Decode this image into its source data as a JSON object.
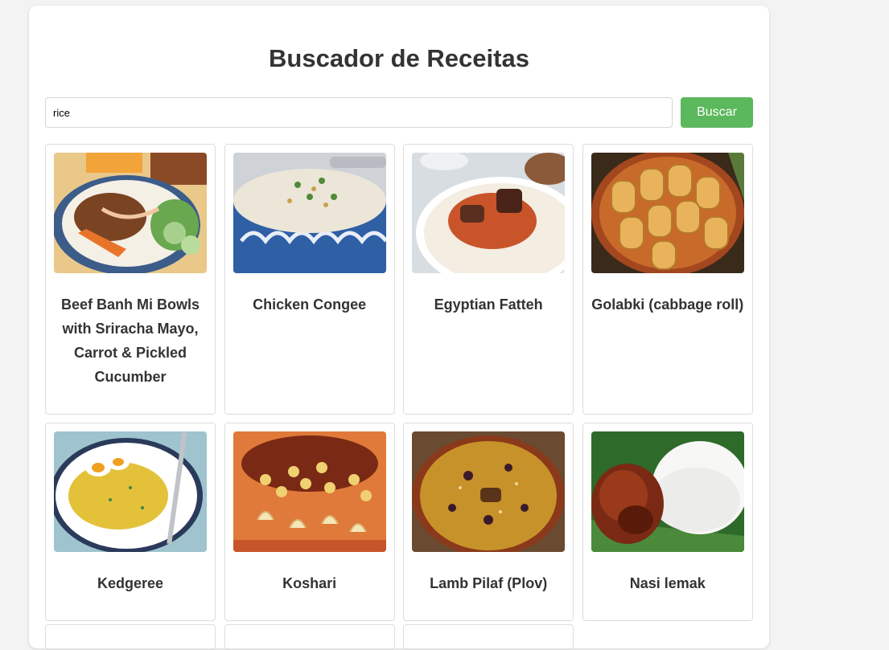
{
  "page": {
    "title": "Buscador de Receitas"
  },
  "search": {
    "value": "rice",
    "button_label": "Buscar"
  },
  "colors": {
    "accent": "#5cb85c",
    "background": "#f3f3f3",
    "card_border": "#dddddd",
    "text": "#333333"
  },
  "recipes": [
    {
      "title": "Beef Banh Mi Bowls with Sriracha Mayo, Carrot & Pickled Cucumber",
      "image": "beef-banh-mi-bowl-photo"
    },
    {
      "title": "Chicken Congee",
      "image": "chicken-congee-photo"
    },
    {
      "title": "Egyptian Fatteh",
      "image": "egyptian-fatteh-photo"
    },
    {
      "title": "Golabki (cabbage roll)",
      "image": "golabki-photo"
    },
    {
      "title": "Kedgeree",
      "image": "kedgeree-photo"
    },
    {
      "title": "Koshari",
      "image": "koshari-photo"
    },
    {
      "title": "Lamb Pilaf (Plov)",
      "image": "lamb-pilaf-photo"
    },
    {
      "title": "Nasi lemak",
      "image": "nasi-lemak-photo"
    }
  ]
}
